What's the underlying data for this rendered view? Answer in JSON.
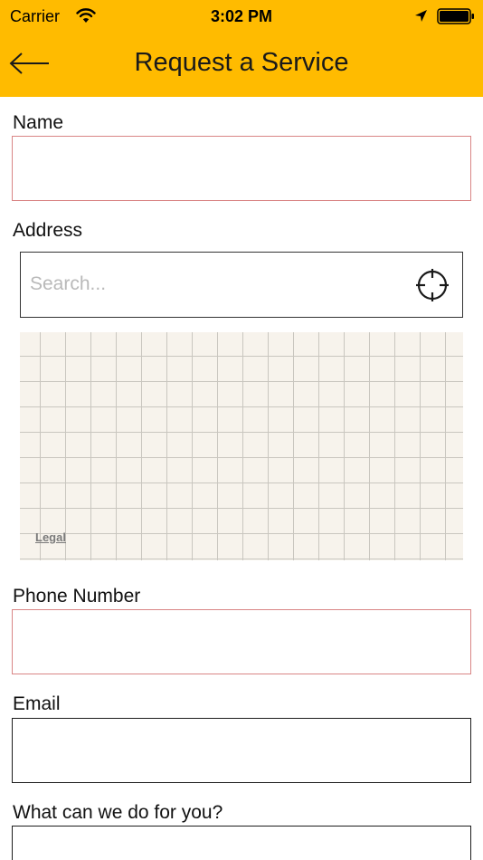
{
  "status_bar": {
    "carrier": "Carrier",
    "time": "3:02 PM",
    "icons": [
      "wifi-icon",
      "location-arrow-icon",
      "battery-icon"
    ]
  },
  "nav": {
    "title": "Request a Service",
    "back_icon": "arrow-left-icon"
  },
  "form": {
    "name": {
      "label": "Name",
      "value": ""
    },
    "address": {
      "label": "Address",
      "search_placeholder": "Search...",
      "locate_icon": "crosshair-icon",
      "map_legal": "Legal"
    },
    "phone": {
      "label": "Phone Number",
      "value": ""
    },
    "email": {
      "label": "Email",
      "value": ""
    },
    "request": {
      "label": "What can we do for you?",
      "value": ""
    }
  },
  "colors": {
    "nav_background": "#FFBB00",
    "invalid_border": "#D98585",
    "field_border": "#1C1C1C",
    "map_background": "#F7F3EC",
    "map_grid": "#C9C6BF",
    "placeholder_text": "#B9B9B9"
  }
}
